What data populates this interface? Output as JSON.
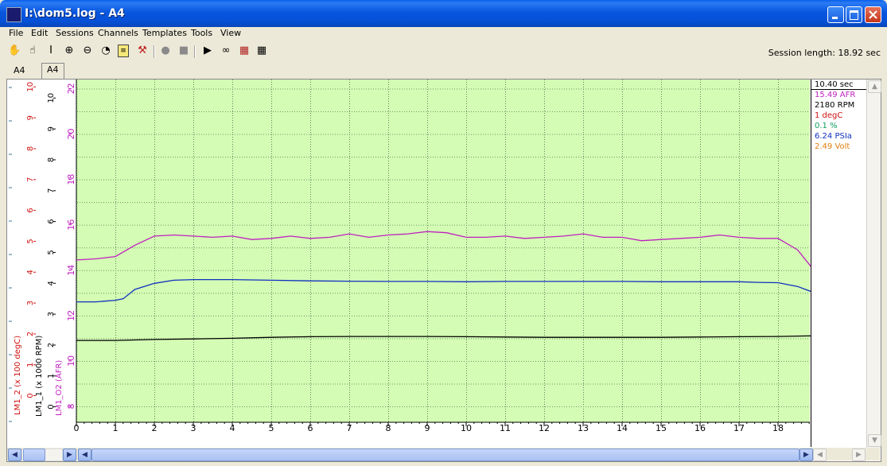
{
  "window": {
    "title": "I:\\dom5.log - A4",
    "minimize_label": "_",
    "maximize_label": "□",
    "close_label": "✕"
  },
  "menu": [
    "File",
    "Edit",
    "Sessions",
    "Channels",
    "Templates",
    "Tools",
    "View"
  ],
  "toolbar": {
    "icons": [
      "hand-pan-icon",
      "hand-grab-icon",
      "text-cursor-icon",
      "zoom-in-icon",
      "zoom-out-icon",
      "zoom-fit-icon",
      "notes-icon",
      "cursor-tool-icon",
      "record-icon",
      "stop-icon",
      "play-icon",
      "binoculars-icon",
      "chart-config-icon",
      "table-icon"
    ],
    "session_length": "Session length:  18.92 sec"
  },
  "tabs": [
    "A4",
    "A4"
  ],
  "readout": [
    {
      "text": "10.40 sec",
      "color": "#000000"
    },
    {
      "text": "15.49 AFR",
      "color": "#c020c0"
    },
    {
      "text": "2180 RPM",
      "color": "#000000"
    },
    {
      "text": "1 degC",
      "color": "#d01010"
    },
    {
      "text": "0.1 %",
      "color": "#10a060"
    },
    {
      "text": "6.24 PSIa",
      "color": "#1030c0"
    },
    {
      "text": "2.49 Volt",
      "color": "#e08010"
    }
  ],
  "axes": {
    "afr_label": "LM1_O2 (AFR)",
    "rpm_label": "LM1_1 (x 1000 RPM)",
    "temp_label": "LM1_2 (x 100 degC)",
    "afr_ticks": [
      "8",
      "10",
      "12",
      "14",
      "16",
      "18",
      "20",
      "22"
    ],
    "rpm_ticks": [
      "0",
      "1",
      "2",
      "3",
      "4",
      "5",
      "6",
      "7",
      "8",
      "9",
      "10"
    ],
    "temp_ticks": [
      "0",
      "1",
      "2",
      "3",
      "4",
      "5",
      "6",
      "7",
      "8",
      "9",
      "10"
    ],
    "x_ticks": [
      "0",
      "1",
      "2",
      "3",
      "4",
      "5",
      "6",
      "7",
      "8",
      "9",
      "10",
      "11",
      "12",
      "13",
      "14",
      "15",
      "16",
      "17",
      "18"
    ]
  },
  "chart_data": {
    "type": "line",
    "xlabel": "",
    "xlim": [
      0,
      18.92
    ],
    "grid": true,
    "series": [
      {
        "name": "LM1_O2 (AFR)",
        "color": "#c020c0",
        "axis": "afr",
        "ylim": [
          7.3,
          22.4
        ],
        "x": [
          0,
          0.5,
          1,
          1.5,
          2,
          2.5,
          3,
          3.5,
          4,
          4.5,
          5,
          5.5,
          6,
          6.5,
          7,
          7.5,
          8,
          8.5,
          9,
          9.5,
          10,
          10.5,
          11,
          11.5,
          12,
          12.5,
          13,
          13.5,
          14,
          14.5,
          15,
          15.5,
          16,
          16.5,
          17,
          17.5,
          18,
          18.5,
          18.92
        ],
        "y": [
          14.45,
          14.5,
          14.6,
          15.1,
          15.5,
          15.55,
          15.5,
          15.45,
          15.5,
          15.35,
          15.4,
          15.5,
          15.4,
          15.45,
          15.6,
          15.45,
          15.55,
          15.6,
          15.7,
          15.65,
          15.45,
          15.45,
          15.5,
          15.4,
          15.45,
          15.5,
          15.6,
          15.45,
          15.45,
          15.3,
          15.35,
          15.4,
          15.45,
          15.55,
          15.45,
          15.4,
          15.4,
          14.9,
          14.0
        ]
      },
      {
        "name": "LM1_1 (x 1000 RPM)",
        "color": "#1030c0",
        "axis": "rpm",
        "ylim": [
          -0.5,
          10.6
        ],
        "x": [
          0,
          0.5,
          1,
          1.2,
          1.5,
          2,
          2.5,
          3,
          3.5,
          4,
          5,
          6,
          7,
          8,
          9,
          10,
          11,
          12,
          13,
          14,
          15,
          16,
          17,
          17.5,
          18,
          18.5,
          18.92
        ],
        "y": [
          3.4,
          3.4,
          3.45,
          3.5,
          3.8,
          4.0,
          4.1,
          4.12,
          4.12,
          4.12,
          4.1,
          4.08,
          4.07,
          4.06,
          4.06,
          4.05,
          4.06,
          4.06,
          4.06,
          4.06,
          4.05,
          4.05,
          4.05,
          4.03,
          4.02,
          3.9,
          3.7
        ]
      },
      {
        "name": "LM1_2 (x 100 degC)",
        "color": "#000000",
        "axis": "temp",
        "ylim": [
          -0.5,
          10.6
        ],
        "x": [
          0,
          1,
          2,
          3,
          4,
          5,
          6,
          7,
          8,
          9,
          10,
          11,
          12,
          13,
          14,
          15,
          16,
          17,
          18,
          18.92
        ],
        "y": [
          2.15,
          2.15,
          2.18,
          2.2,
          2.22,
          2.25,
          2.27,
          2.28,
          2.28,
          2.28,
          2.27,
          2.26,
          2.25,
          2.25,
          2.25,
          2.25,
          2.26,
          2.27,
          2.28,
          2.3
        ]
      }
    ]
  }
}
